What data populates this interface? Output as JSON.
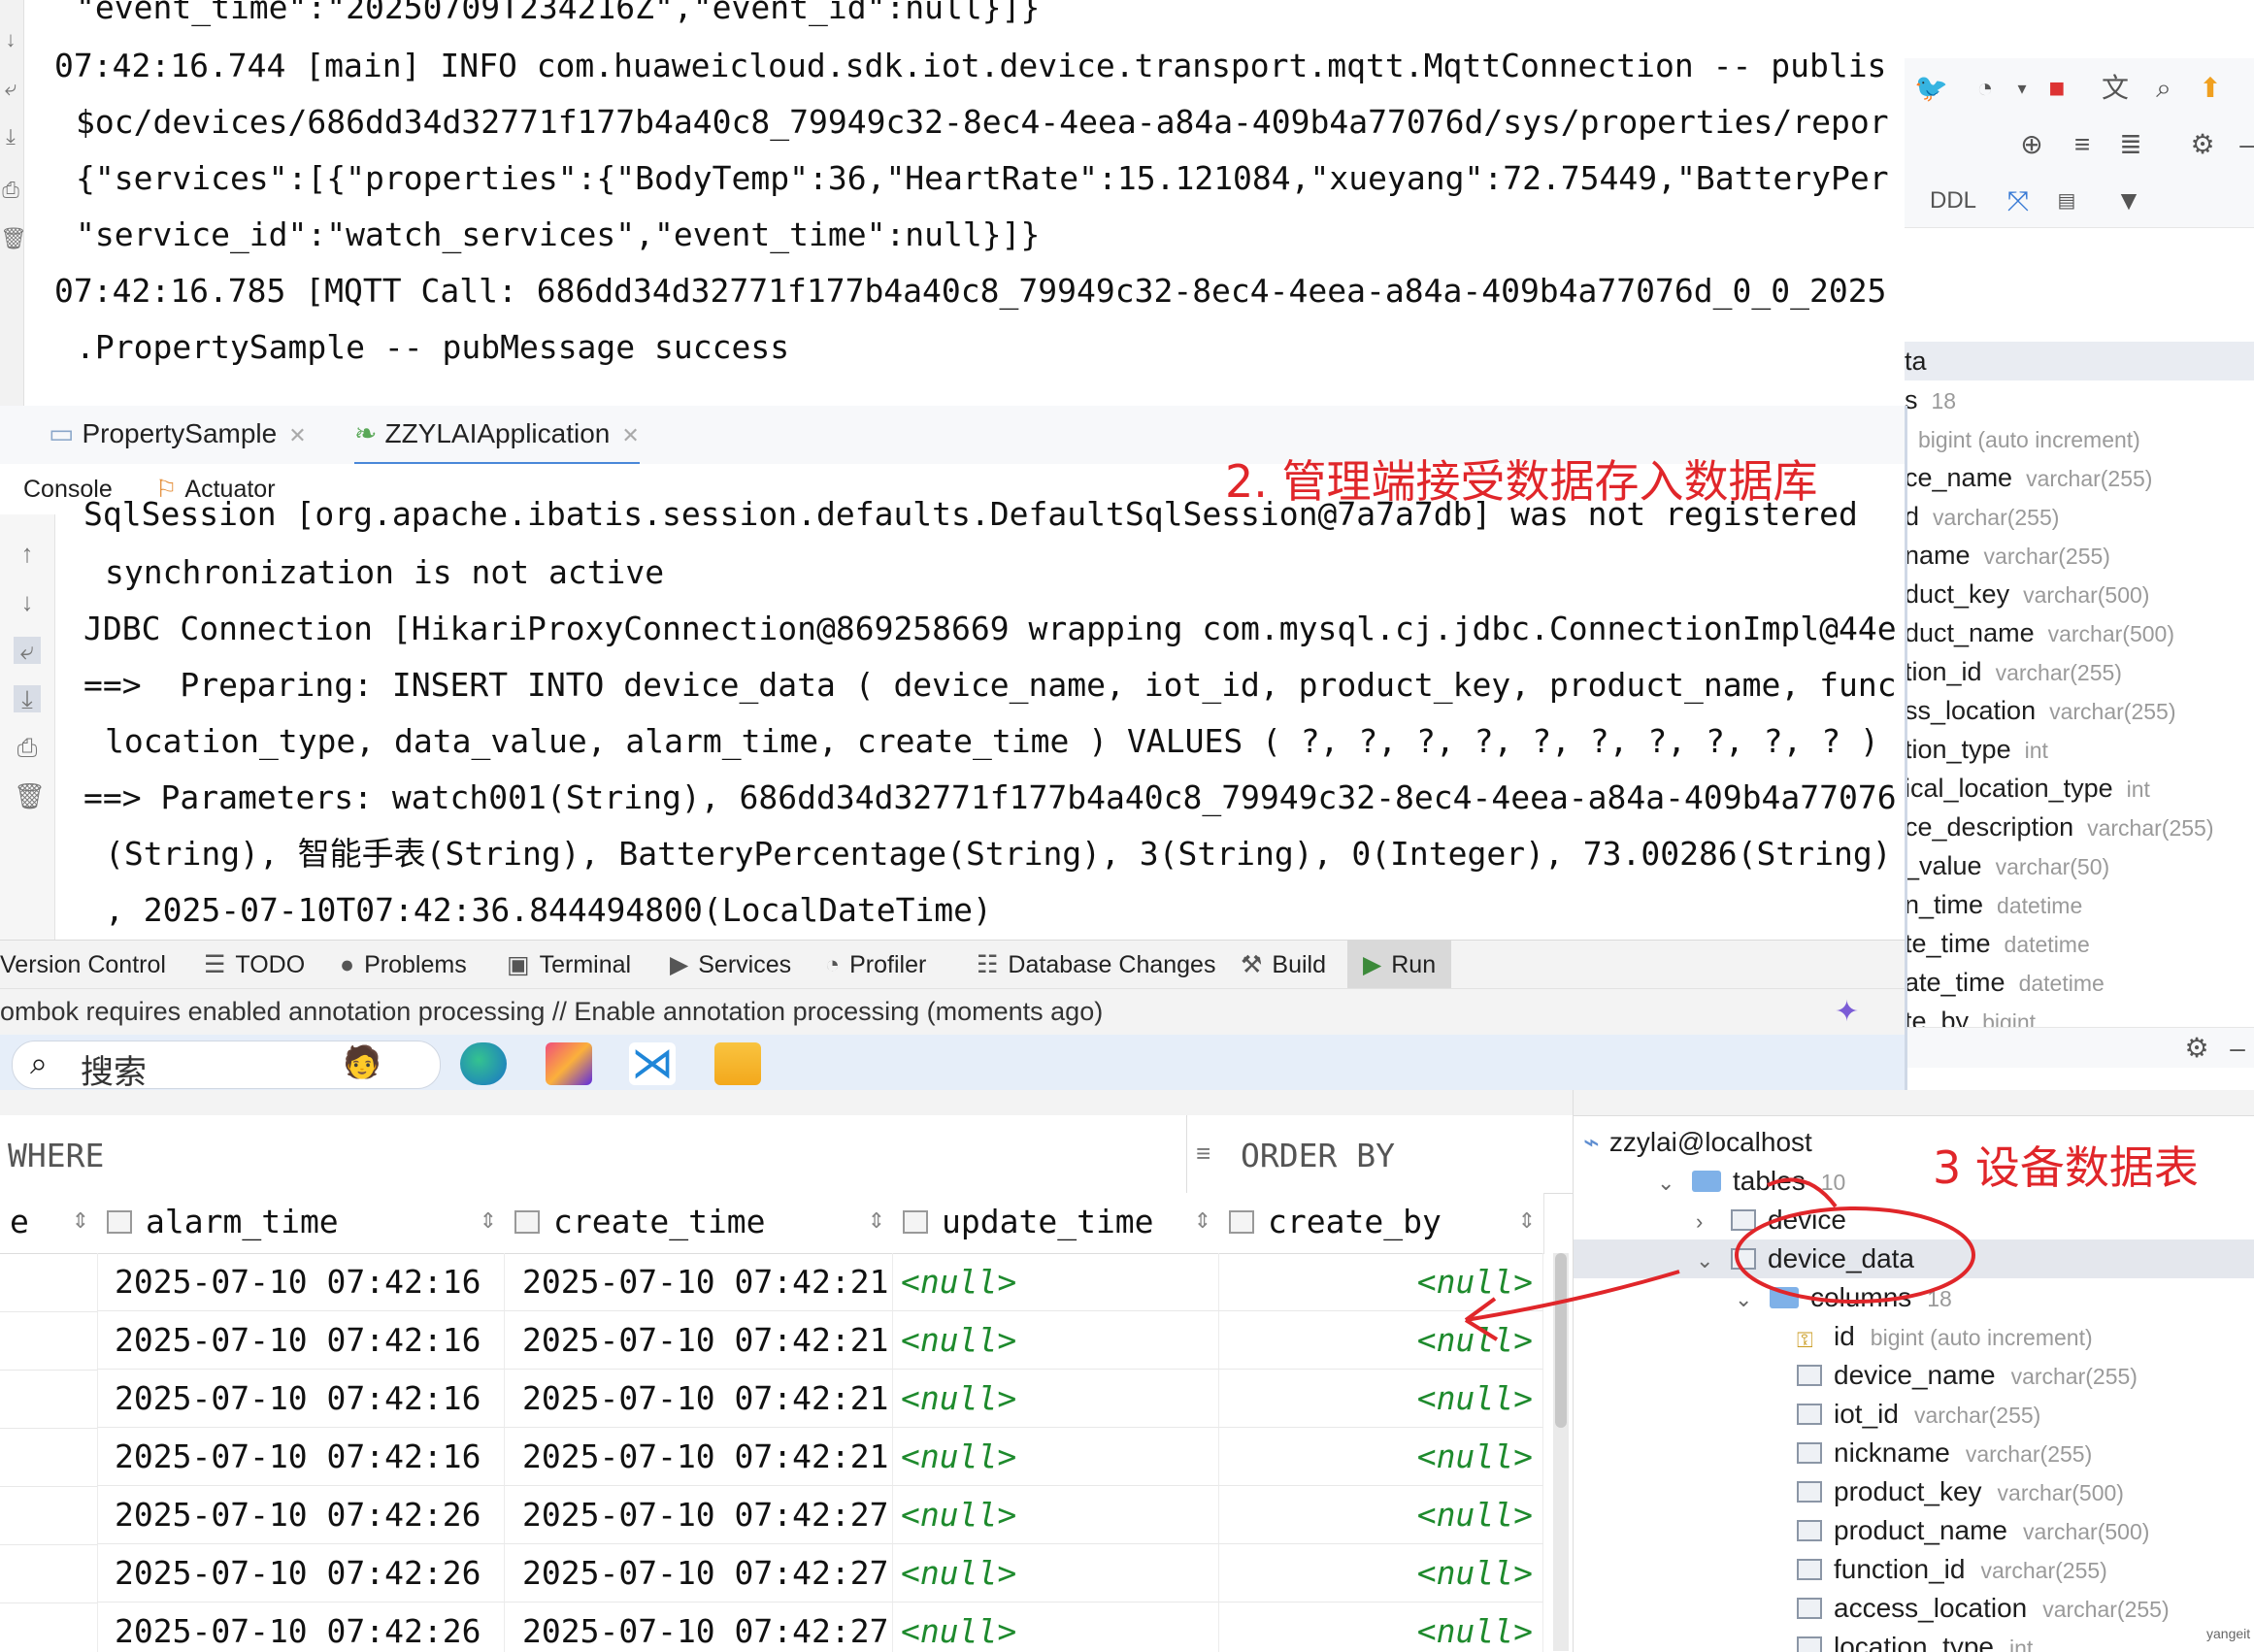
{
  "top_console": {
    "lines": [
      "\"event_time\":\"20250709T234216Z\",\"event_id\":null}]}",
      "07:42:16.744 [main] INFO com.huaweicloud.sdk.iot.device.transport.mqtt.MqttConnection -- publis",
      "$oc/devices/686dd34d32771f177b4a40c8_79949c32-8ec4-4eea-a84a-409b4a77076d/sys/properties/repor",
      "{\"services\":[{\"properties\":{\"BodyTemp\":36,\"HeartRate\":15.121084,\"xueyang\":72.75449,\"BatteryPer",
      "\"service_id\":\"watch_services\",\"event_time\":null}]}",
      "07:42:16.785 [MQTT Call: 686dd34d32771f177b4a40c8_79949c32-8ec4-4eea-a84a-409b4a77076d_0_0_2025",
      ".PropertySample -- pubMessage success"
    ]
  },
  "db_top": {
    "rows": [
      {
        "name": "ta",
        "type": ""
      },
      {
        "name": "s",
        "type": "18"
      },
      {
        "name": "",
        "type": "bigint (auto increment)"
      },
      {
        "name": "ce_name",
        "type": "varchar(255)"
      },
      {
        "name": "d",
        "type": "varchar(255)"
      },
      {
        "name": "name",
        "type": "varchar(255)"
      },
      {
        "name": "duct_key",
        "type": "varchar(500)"
      },
      {
        "name": "duct_name",
        "type": "varchar(500)"
      },
      {
        "name": "tion_id",
        "type": "varchar(255)"
      },
      {
        "name": "ss_location",
        "type": "varchar(255)"
      },
      {
        "name": "tion_type",
        "type": "int"
      },
      {
        "name": "ical_location_type",
        "type": "int"
      },
      {
        "name": "ce_description",
        "type": "varchar(255)"
      },
      {
        "name": "_value",
        "type": "varchar(50)"
      },
      {
        "name": "n_time",
        "type": "datetime"
      },
      {
        "name": "te_time",
        "type": "datetime"
      },
      {
        "name": "ate_time",
        "type": "datetime"
      },
      {
        "name": "te_by",
        "type": "bigint"
      }
    ],
    "ddl_label": "DDL"
  },
  "run_window": {
    "tabs": [
      {
        "label": "PropertySample"
      },
      {
        "label": "ZZYLAIApplication"
      }
    ],
    "subtabs": {
      "console": "Console",
      "actuator": "Actuator"
    },
    "annotation": "2. 管理端接受数据存入数据库",
    "lines": [
      "SqlSession [org.apache.ibatis.session.defaults.DefaultSqlSession@7a7a7db] was not registered",
      "synchronization is not active",
      "JDBC Connection [HikariProxyConnection@869258669 wrapping com.mysql.cj.jdbc.ConnectionImpl@44e",
      "==>  Preparing: INSERT INTO device_data ( device_name, iot_id, product_key, product_name, func",
      "location_type, data_value, alarm_time, create_time ) VALUES ( ?, ?, ?, ?, ?, ?, ?, ?, ?, ? )",
      "==> Parameters: watch001(String), 686dd34d32771f177b4a40c8_79949c32-8ec4-4eea-a84a-409b4a77076",
      "(String), 智能手表(String), BatteryPercentage(String), 3(String), 0(Integer), 73.00286(String)",
      ", 2025-07-10T07:42:36.844494800(LocalDateTime)"
    ],
    "tool_windows": [
      "Version Control",
      "TODO",
      "Problems",
      "Terminal",
      "Services",
      "Profiler",
      "Database Changes",
      "Build",
      "Run"
    ],
    "status": "ombok requires enabled annotation processing // Enable annotation processing (moments ago)",
    "search_placeholder": "搜索"
  },
  "grid": {
    "where_label": "WHERE",
    "order_label": "ORDER BY",
    "columns": [
      "e",
      "alarm_time",
      "create_time",
      "update_time",
      "create_by"
    ],
    "rows": [
      [
        "2025-07-10 07:42:16",
        "2025-07-10 07:42:21",
        "<null>",
        "<null>"
      ],
      [
        "2025-07-10 07:42:16",
        "2025-07-10 07:42:21",
        "<null>",
        "<null>"
      ],
      [
        "2025-07-10 07:42:16",
        "2025-07-10 07:42:21",
        "<null>",
        "<null>"
      ],
      [
        "2025-07-10 07:42:16",
        "2025-07-10 07:42:21",
        "<null>",
        "<null>"
      ],
      [
        "2025-07-10 07:42:26",
        "2025-07-10 07:42:27",
        "<null>",
        "<null>"
      ],
      [
        "2025-07-10 07:42:26",
        "2025-07-10 07:42:27",
        "<null>",
        "<null>"
      ],
      [
        "2025-07-10 07:42:26",
        "2025-07-10 07:42:27",
        "<null>",
        "<null>"
      ]
    ]
  },
  "db_tree": {
    "connection": "zzylai@localhost",
    "tables_label": "tables",
    "tables_count": "10",
    "device": "device",
    "device_data": "device_data",
    "columns_label": "columns",
    "columns_count": "18",
    "annotation": "3 设备数据表",
    "columns": [
      {
        "name": "id",
        "type": "bigint (auto increment)"
      },
      {
        "name": "device_name",
        "type": "varchar(255)"
      },
      {
        "name": "iot_id",
        "type": "varchar(255)"
      },
      {
        "name": "nickname",
        "type": "varchar(255)"
      },
      {
        "name": "product_key",
        "type": "varchar(500)"
      },
      {
        "name": "product_name",
        "type": "varchar(500)"
      },
      {
        "name": "function_id",
        "type": "varchar(255)"
      },
      {
        "name": "access_location",
        "type": "varchar(255)"
      },
      {
        "name": "location_type",
        "type": "int"
      }
    ],
    "watermark": "yangeit"
  },
  "colors": {
    "annotation_red": "#e0262a",
    "null_green": "#1e8a2d",
    "type_gray": "#9a9a9a"
  }
}
